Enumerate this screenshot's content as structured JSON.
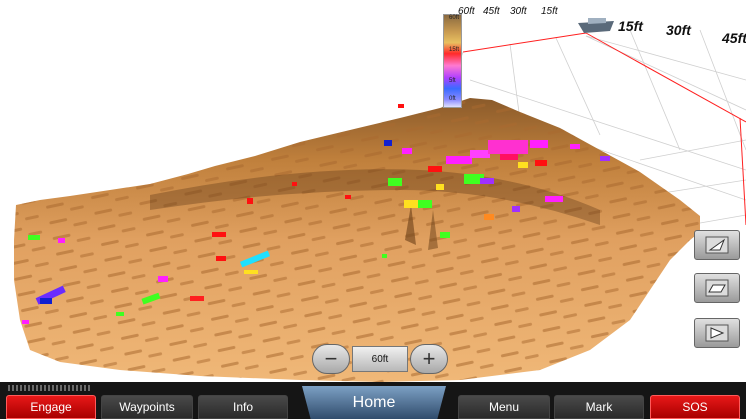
{
  "depth_scale": {
    "top_labels": [
      "60ft",
      "45ft",
      "30ft",
      "15ft"
    ],
    "big_labels": [
      "15ft",
      "30ft",
      "45ft"
    ],
    "bar_ticks": [
      "60ft",
      "15ft",
      "5ft",
      "0ft"
    ]
  },
  "zoom": {
    "minus": "−",
    "value": "60ft",
    "plus": "+"
  },
  "side_buttons": [
    {
      "icon": "view-angle-icon"
    },
    {
      "icon": "view-flat-icon"
    },
    {
      "icon": "view-side-icon"
    }
  ],
  "bottom_nav": {
    "engage": "Engage",
    "waypoints": "Waypoints",
    "info": "Info",
    "home": "Home",
    "menu": "Menu",
    "mark": "Mark",
    "sos": "SOS"
  },
  "colors": {
    "engage": "#d60000",
    "sos": "#d60000",
    "home": "#4f7aa6",
    "bottom_bar": "#151515",
    "seafloor": "#c8864a"
  }
}
